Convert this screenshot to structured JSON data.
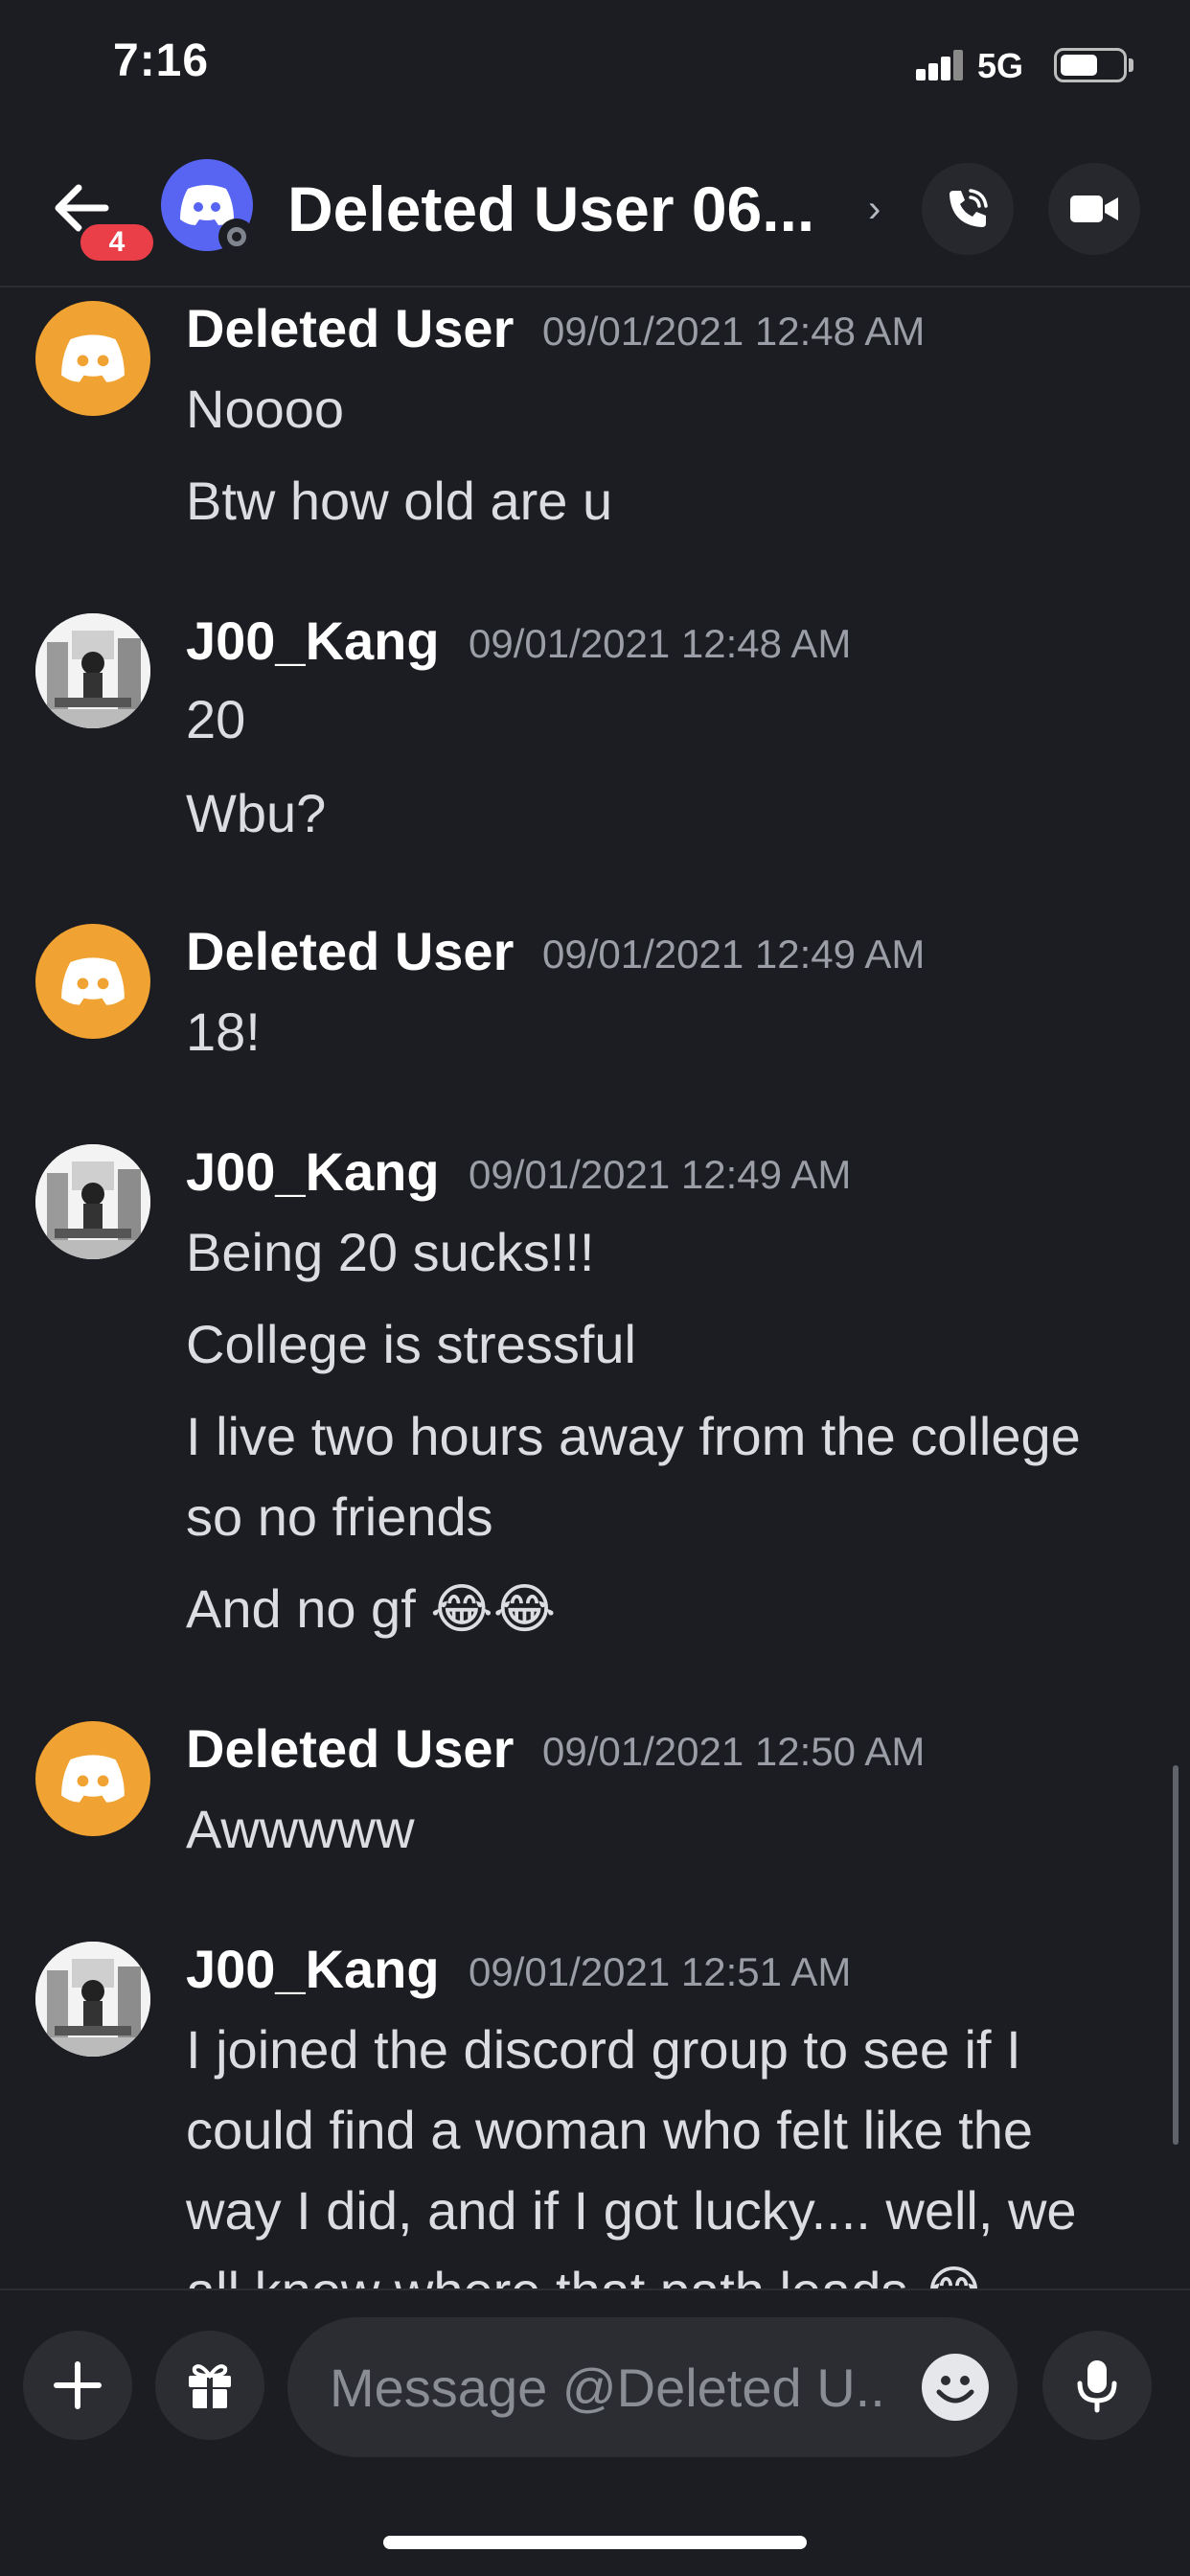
{
  "status_bar": {
    "time": "7:16",
    "network": "5G"
  },
  "header": {
    "unread_badge": "4",
    "title": "Deleted User 06...",
    "chevron": "›"
  },
  "messages": [
    {
      "author": "Deleted User",
      "timestamp": "09/01/2021 12:48 AM",
      "avatar": "discord-default-avatar",
      "lines": [
        "Noooo",
        "Btw how old are u"
      ]
    },
    {
      "author": "J00_Kang",
      "timestamp": "09/01/2021 12:48 AM",
      "avatar": "user-photo-avatar",
      "lines": [
        "20",
        "Wbu?"
      ]
    },
    {
      "author": "Deleted User",
      "timestamp": "09/01/2021 12:49 AM",
      "avatar": "discord-default-avatar",
      "lines": [
        "18!"
      ]
    },
    {
      "author": "J00_Kang",
      "timestamp": "09/01/2021 12:49 AM",
      "avatar": "user-photo-avatar",
      "lines": [
        "Being 20 sucks!!!",
        "College is stressful",
        "I live two hours away from the college",
        "so no friends",
        "And no gf 😂😂"
      ]
    },
    {
      "author": "Deleted User",
      "timestamp": "09/01/2021 12:50 AM",
      "avatar": "discord-default-avatar",
      "lines": [
        "Awwwww"
      ]
    },
    {
      "author": "J00_Kang",
      "timestamp": "09/01/2021 12:51 AM",
      "avatar": "user-photo-avatar",
      "lines": [
        "I joined the discord group to see if I",
        "could find a woman who felt like the",
        "way I did, and if I got lucky.... well, we",
        "all know where that path leads 😂"
      ]
    }
  ],
  "composer": {
    "placeholder": "Message @Deleted U.."
  },
  "colors": {
    "background": "#1c1d22",
    "accent": "#5865f2",
    "badge": "#ea3f48",
    "default_avatar": "#f0a232"
  }
}
